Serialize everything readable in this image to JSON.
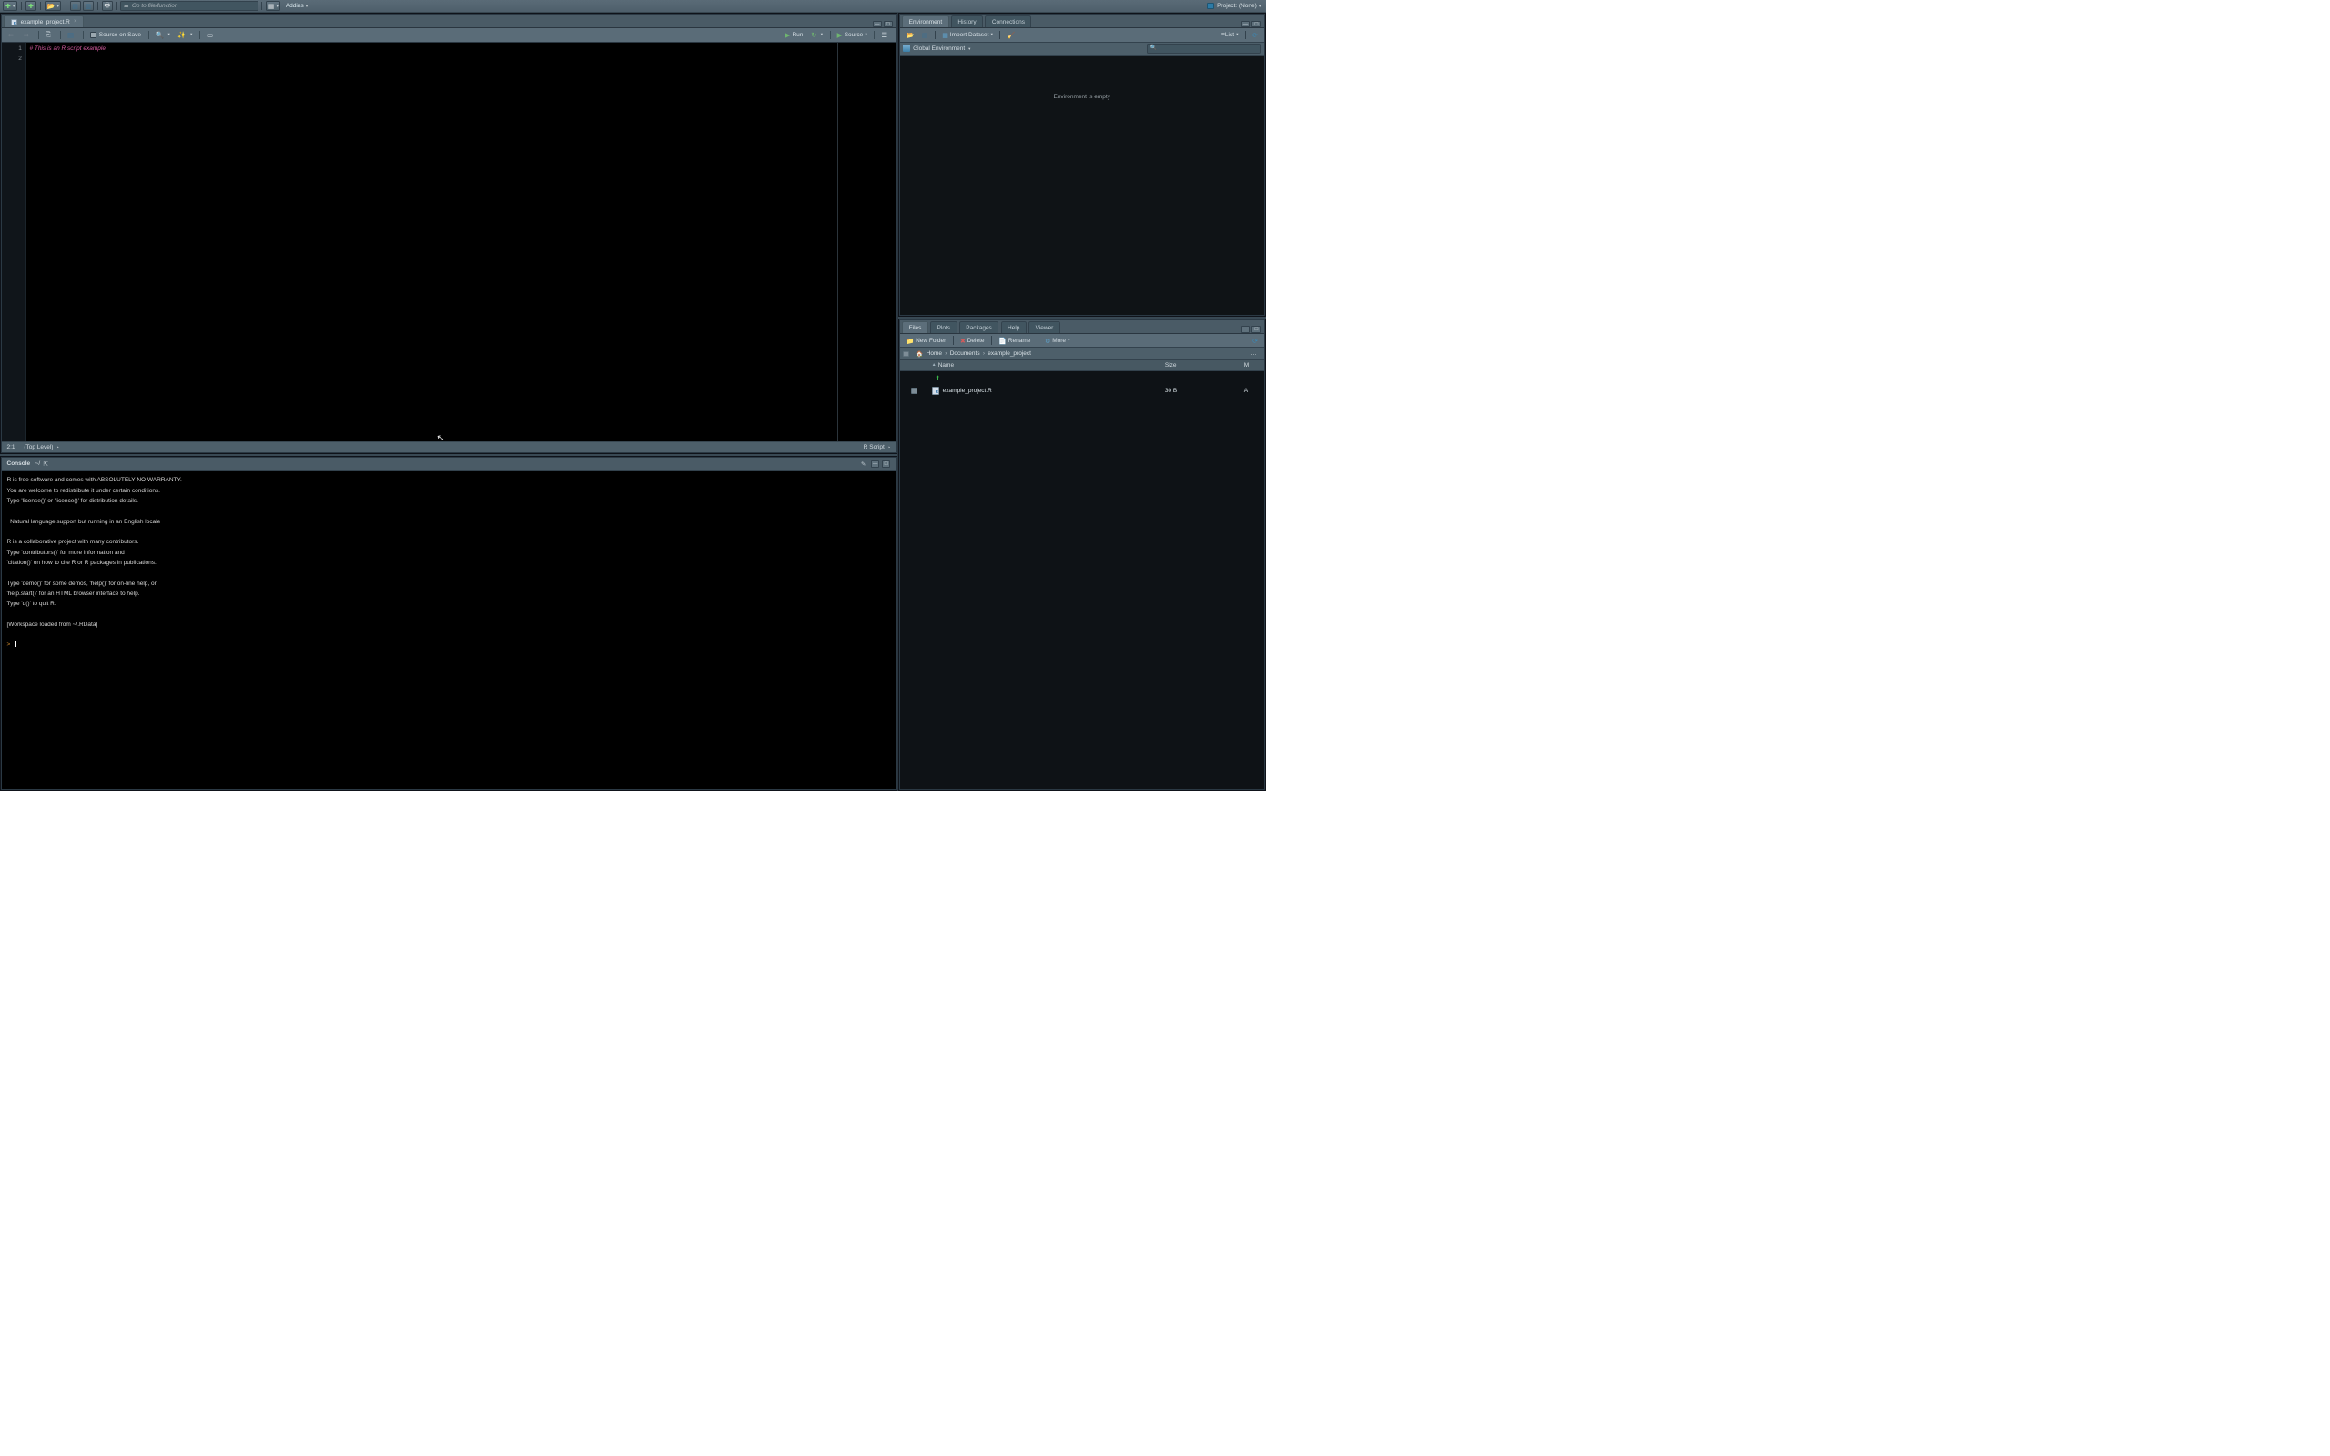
{
  "top": {
    "goto_placeholder": "Go to file/function",
    "addins": "Addins",
    "project_label": "Project: (None)"
  },
  "source": {
    "tab_name": "example_project.R",
    "source_on_save": "Source on Save",
    "run": "Run",
    "source_btn": "Source",
    "gutter_lines": [
      "1",
      "2"
    ],
    "code_line1": "# This is an R script example",
    "status_pos": "2:1",
    "status_scope": "(Top Level)",
    "status_lang": "R Script"
  },
  "console": {
    "title": "Console",
    "cwd": "~/",
    "body": "R is free software and comes with ABSOLUTELY NO WARRANTY.\nYou are welcome to redistribute it under certain conditions.\nType 'license()' or 'licence()' for distribution details.\n\n  Natural language support but running in an English locale\n\nR is a collaborative project with many contributors.\nType 'contributors()' for more information and\n'citation()' on how to cite R or R packages in publications.\n\nType 'demo()' for some demos, 'help()' for on-line help, or\n'help.start()' for an HTML browser interface to help.\nType 'q()' to quit R.\n\n[Workspace loaded from ~/.RData]\n",
    "prompt": ">"
  },
  "env": {
    "tabs": [
      "Environment",
      "History",
      "Connections"
    ],
    "import": "Import Dataset",
    "list": "List",
    "scope": "Global Environment",
    "empty_msg": "Environment is empty"
  },
  "files": {
    "tabs": [
      "Files",
      "Plots",
      "Packages",
      "Help",
      "Viewer"
    ],
    "new_folder": "New Folder",
    "delete": "Delete",
    "rename": "Rename",
    "more": "More",
    "breadcrumb": {
      "home": "Home",
      "documents": "Documents",
      "folder": "example_project"
    },
    "cols": {
      "name": "Name",
      "size": "Size",
      "mod": "M"
    },
    "rows": [
      {
        "name": "..",
        "size": "",
        "mod": ""
      },
      {
        "name": "example_project.R",
        "size": "30 B",
        "mod": "A"
      }
    ]
  }
}
